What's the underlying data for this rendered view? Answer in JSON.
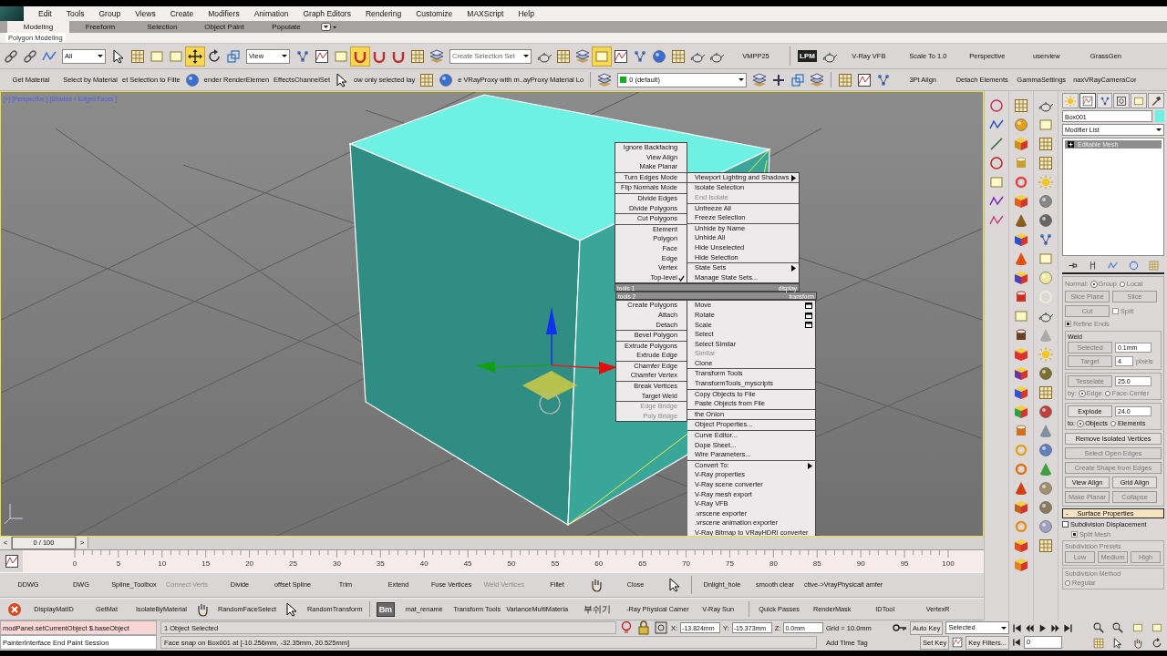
{
  "menu_bar": [
    "Edit",
    "Tools",
    "Group",
    "Views",
    "Create",
    "Modifiers",
    "Animation",
    "Graph Editors",
    "Rendering",
    "Customize",
    "MAXScript",
    "Help"
  ],
  "ribbon": {
    "tabs": [
      {
        "label": "Modeling",
        "selected": true
      },
      {
        "label": "Freeform",
        "selected": false
      },
      {
        "label": "Selection",
        "selected": false
      },
      {
        "label": "Object Paint",
        "selected": false
      },
      {
        "label": "Populate",
        "selected": false
      }
    ],
    "panel": "Polygon Modeling"
  },
  "main_toolbar": {
    "groups": [
      [
        {
          "kind": "icon",
          "selected": false
        },
        {
          "kind": "icon",
          "selected": false
        },
        {
          "kind": "icon",
          "selected": false
        },
        {
          "kind": "dropdown",
          "value": "All",
          "selected": false
        },
        {
          "kind": "icon",
          "selected": false
        },
        {
          "kind": "icon",
          "selected": false
        },
        {
          "kind": "icon",
          "selected": false
        },
        {
          "kind": "icon",
          "selected": false
        },
        {
          "kind": "icon",
          "selected": true
        },
        {
          "kind": "icon",
          "selected": false
        },
        {
          "kind": "icon",
          "selected": false
        },
        {
          "kind": "dropdown",
          "value": "View",
          "selected": false
        },
        {
          "kind": "icon",
          "selected": false
        },
        {
          "kind": "icon",
          "selected": false
        },
        {
          "kind": "icon",
          "selected": false
        },
        {
          "kind": "icon",
          "selected": true
        },
        {
          "kind": "icon",
          "selected": false
        },
        {
          "kind": "icon",
          "selected": false
        },
        {
          "kind": "icon",
          "selected": false
        },
        {
          "kind": "icon",
          "selected": false
        },
        {
          "kind": "dropdown",
          "placeholder": "Create Selection Set",
          "selected": false
        },
        {
          "kind": "icon",
          "selected": false
        },
        {
          "kind": "icon",
          "selected": false
        },
        {
          "kind": "icon",
          "selected": false
        },
        {
          "kind": "icon",
          "selected": true
        },
        {
          "kind": "icon",
          "selected": false
        },
        {
          "kind": "icon",
          "selected": false
        },
        {
          "kind": "icon",
          "selected": false
        },
        {
          "kind": "icon",
          "selected": false
        },
        {
          "kind": "icon",
          "selected": false
        },
        {
          "kind": "icon",
          "selected": false
        },
        {
          "kind": "text",
          "label": "VMPP25",
          "selected": false
        }
      ],
      [
        {
          "kind": "badge",
          "label": "LPM",
          "selected": false
        },
        {
          "kind": "icon",
          "selected": false
        },
        {
          "kind": "text",
          "label": "V-Ray VFB",
          "selected": false
        },
        {
          "kind": "text",
          "label": "Scale To 1.0",
          "selected": false
        },
        {
          "kind": "text",
          "label": "Perspective",
          "selected": false
        },
        {
          "kind": "text",
          "label": "userview",
          "selected": false
        },
        {
          "kind": "text",
          "label": "GrassGen",
          "selected": false
        }
      ]
    ]
  },
  "second_toolbar": {
    "groups": [
      [
        {
          "kind": "text",
          "label": "Get Material",
          "selected": false
        },
        {
          "kind": "text",
          "label": "Select by Material",
          "selected": false
        },
        {
          "kind": "text",
          "label": "et Selection to Filte",
          "selected": false
        },
        {
          "kind": "icon",
          "selected": false
        },
        {
          "kind": "text",
          "label": "ender RenderElemen",
          "selected": false
        },
        {
          "kind": "text",
          "label": "EffectsChannelSet",
          "selected": false
        },
        {
          "kind": "icon",
          "selected": false
        },
        {
          "kind": "text",
          "label": "ow only selected lay",
          "selected": false
        },
        {
          "kind": "icon",
          "selected": false
        },
        {
          "kind": "icon",
          "selected": false
        },
        {
          "kind": "text",
          "label": "e VRayProxy with m..ayProxy Material Lo",
          "selected": false
        }
      ],
      [
        {
          "kind": "icon",
          "selected": false
        },
        {
          "kind": "layer",
          "value": "0 (default)",
          "selected": false
        },
        {
          "kind": "icon",
          "selected": false
        },
        {
          "kind": "icon",
          "selected": false
        },
        {
          "kind": "icon",
          "selected": false
        },
        {
          "kind": "icon",
          "selected": false
        }
      ],
      [
        {
          "kind": "icon",
          "selected": false
        },
        {
          "kind": "icon",
          "selected": false
        },
        {
          "kind": "icon",
          "selected": false
        },
        {
          "kind": "text",
          "label": "3Pt Align",
          "selected": false
        },
        {
          "kind": "text",
          "label": "Detach Elements",
          "selected": false
        },
        {
          "kind": "text",
          "label": "GammaSettings",
          "selected": false
        },
        {
          "kind": "text",
          "label": "naxVRayCameraCor",
          "selected": false
        }
      ]
    ]
  },
  "viewport": {
    "label": "[+] [Perspective ] [Shaded + Edged Faces ]"
  },
  "quad_menu": {
    "quadrants": [
      {
        "title": "tools 1",
        "groups": [
          [
            {
              "label": "Ignore Backfacing",
              "disabled": false,
              "checked": false
            },
            {
              "label": "View Align",
              "disabled": false,
              "checked": false
            },
            {
              "label": "Make Planar",
              "disabled": false,
              "checked": false
            }
          ],
          [
            {
              "label": "Turn Edges Mode",
              "disabled": false,
              "checked": false
            }
          ],
          [
            {
              "label": "Flip Normals Mode",
              "disabled": false,
              "checked": false
            }
          ],
          [
            {
              "label": "Divide Edges",
              "disabled": false,
              "checked": false
            },
            {
              "label": "Divide Polygons",
              "disabled": false,
              "checked": false
            }
          ],
          [
            {
              "label": "Cut Polygons",
              "disabled": false,
              "checked": false
            }
          ],
          [
            {
              "label": "Element",
              "disabled": false,
              "checked": false
            },
            {
              "label": "Polygon",
              "disabled": false,
              "checked": false
            },
            {
              "label": "Face",
              "disabled": false,
              "checked": false
            },
            {
              "label": "Edge",
              "disabled": false,
              "checked": false
            },
            {
              "label": "Vertex",
              "disabled": false,
              "checked": false
            },
            {
              "label": "Top-level",
              "disabled": false,
              "checked": true
            }
          ]
        ]
      },
      {
        "title": "display",
        "groups": [
          [
            {
              "label": "Viewport Lighting and Shadows",
              "disabled": false,
              "kind": "submenu"
            }
          ],
          [
            {
              "label": "Isolate Selection",
              "disabled": false,
              "kind": "item"
            },
            {
              "label": "End Isolate",
              "disabled": true,
              "kind": "item"
            }
          ],
          [
            {
              "label": "Unfreeze All",
              "disabled": false,
              "kind": "item"
            },
            {
              "label": "Freeze Selection",
              "disabled": false,
              "kind": "item"
            }
          ],
          [
            {
              "label": "Unhide by Name",
              "disabled": false,
              "kind": "item"
            },
            {
              "label": "Unhide All",
              "disabled": false,
              "kind": "item"
            },
            {
              "label": "Hide Unselected",
              "disabled": false,
              "kind": "item"
            },
            {
              "label": "Hide Selection",
              "disabled": false,
              "kind": "item"
            }
          ],
          [
            {
              "label": "State Sets",
              "disabled": false,
              "kind": "submenu"
            },
            {
              "label": "Manage State Sets...",
              "disabled": false,
              "kind": "item"
            }
          ]
        ]
      },
      {
        "title": "tools 2",
        "groups": [
          [
            {
              "label": "Create Polygons",
              "disabled": false
            },
            {
              "label": "Attach",
              "disabled": false
            },
            {
              "label": "Detach",
              "disabled": false
            }
          ],
          [
            {
              "label": "Bevel Polygon",
              "disabled": false
            }
          ],
          [
            {
              "label": "Extrude Polygons",
              "disabled": false
            },
            {
              "label": "Extrude Edge",
              "disabled": false
            }
          ],
          [
            {
              "label": "Chamfer Edge",
              "disabled": false
            },
            {
              "label": "Chamfer Vertex",
              "disabled": false
            }
          ],
          [
            {
              "label": "Break Vertices",
              "disabled": false
            },
            {
              "label": "Target Weld",
              "disabled": false
            }
          ],
          [
            {
              "label": "Edge Bridge",
              "disabled": true
            },
            {
              "label": "Poly Bridge",
              "disabled": true
            }
          ]
        ]
      },
      {
        "title": "transform",
        "groups": [
          [
            {
              "label": "Move",
              "disabled": false,
              "kind": "options"
            },
            {
              "label": "Rotate",
              "disabled": false,
              "kind": "options"
            },
            {
              "label": "Scale",
              "disabled": false,
              "kind": "options"
            },
            {
              "label": "Select",
              "disabled": false,
              "kind": "item"
            },
            {
              "label": "Select Similar",
              "disabled": false,
              "kind": "item"
            },
            {
              "label": "Similar",
              "disabled": true,
              "kind": "item"
            },
            {
              "label": "Clone",
              "disabled": false,
              "kind": "item"
            }
          ],
          [
            {
              "label": "Transform Tools",
              "disabled": false,
              "kind": "item"
            },
            {
              "label": "TransformTools_myscripts",
              "disabled": false,
              "kind": "item"
            }
          ],
          [
            {
              "label": "Copy Objects to File",
              "disabled": false,
              "kind": "item"
            },
            {
              "label": "Paste Objects from File",
              "disabled": false,
              "kind": "item"
            }
          ],
          [
            {
              "label": "the Onion",
              "disabled": false,
              "kind": "item"
            }
          ],
          [
            {
              "label": "Object Properties...",
              "disabled": false,
              "kind": "item"
            }
          ],
          [
            {
              "label": "Curve Editor...",
              "disabled": false,
              "kind": "item"
            },
            {
              "label": "Dope Sheet...",
              "disabled": false,
              "kind": "item"
            },
            {
              "label": "Wire Parameters...",
              "disabled": false,
              "kind": "item"
            }
          ],
          [
            {
              "label": "Convert To:",
              "disabled": false,
              "kind": "submenu"
            },
            {
              "label": "V-Ray properties",
              "disabled": false,
              "kind": "item"
            },
            {
              "label": "V-Ray scene converter",
              "disabled": false,
              "kind": "item"
            },
            {
              "label": "V-Ray mesh export",
              "disabled": false,
              "kind": "item"
            },
            {
              "label": "V-Ray VFB",
              "disabled": false,
              "kind": "item"
            },
            {
              "label": ".vrscene exporter",
              "disabled": false,
              "kind": "item"
            },
            {
              "label": ".vrscene animation exporter",
              "disabled": false,
              "kind": "item"
            },
            {
              "label": "V-Ray Bitmap to VRayHDRI converter",
              "disabled": false,
              "kind": "item"
            }
          ]
        ]
      }
    ]
  },
  "command_panel": {
    "tabs": [
      {
        "selected": false
      },
      {
        "selected": true
      },
      {
        "selected": false
      },
      {
        "selected": false
      },
      {
        "selected": false
      },
      {
        "selected": false
      }
    ],
    "object_name": "Box001",
    "modifier_list": "Modifier List",
    "stack": [
      {
        "label": "Editable Mesh",
        "selected": true
      }
    ],
    "normal": {
      "label": "Normal:",
      "options": [
        {
          "label": "Group",
          "selected": true
        },
        {
          "label": "Local",
          "selected": false
        }
      ]
    },
    "slice_buttons": [
      {
        "label": "Slice Plane",
        "disabled": true
      },
      {
        "label": "Slice",
        "disabled": true
      }
    ],
    "cut_button": {
      "label": "Cut",
      "disabled": true
    },
    "split": {
      "label": "Split",
      "checked": false,
      "disabled": true
    },
    "refine_ends": {
      "label": "Refine Ends",
      "checked": true,
      "disabled": true
    },
    "weld": {
      "title": "Weld",
      "rows": [
        {
          "button": "Selected",
          "value": "0.1mm",
          "disabled": true
        },
        {
          "button": "Target",
          "value": "4",
          "suffix": "pixels",
          "disabled": true
        }
      ]
    },
    "tessellate": {
      "button": "Tesselate",
      "value": "25.0",
      "disabled": true,
      "label": "by:",
      "options": [
        {
          "label": "Edge",
          "selected": true
        },
        {
          "label": "Face-Center",
          "selected": false
        }
      ]
    },
    "explode": {
      "button": "Explode",
      "value": "24.0",
      "disabled": false,
      "label": "to:",
      "options": [
        {
          "label": "Objects",
          "selected": true
        },
        {
          "label": "Elements",
          "selected": false
        }
      ]
    },
    "wide_buttons": [
      {
        "label": "Remove Isolated Vertices",
        "disabled": false
      },
      {
        "label": "Select Open Edges",
        "disabled": true
      },
      {
        "label": "Create Shape from Edges",
        "disabled": true
      }
    ],
    "button_pairs": [
      [
        {
          "label": "View Align",
          "disabled": false
        },
        {
          "label": "Grid Align",
          "disabled": false
        }
      ],
      [
        {
          "label": "Make Planar",
          "disabled": true
        },
        {
          "label": "Collapse",
          "disabled": true
        }
      ]
    ],
    "surface": {
      "toggle": "-",
      "title": "Surface Properties",
      "checkboxes": [
        {
          "label": "Subdivision Displacement",
          "checked": false,
          "disabled": false
        },
        {
          "label": "Split Mesh",
          "checked": true,
          "disabled": true
        }
      ],
      "presets": {
        "title": "Subdivision Presets",
        "buttons": [
          {
            "label": "Low",
            "disabled": true
          },
          {
            "label": "Medium",
            "disabled": true
          },
          {
            "label": "High",
            "disabled": true
          }
        ]
      },
      "method": {
        "title": "Subdivision Method",
        "options": [
          {
            "label": "Regular",
            "selected": false
          }
        ]
      }
    }
  },
  "time_slider": {
    "prev": "<",
    "label": "0 / 100",
    "next": ">",
    "level": 0
  },
  "ruler_labels": [
    "0",
    "5",
    "10",
    "15",
    "20",
    "25",
    "30",
    "35",
    "40",
    "45",
    "50",
    "55",
    "60",
    "65",
    "70",
    "75",
    "80",
    "85",
    "90",
    "95",
    "100"
  ],
  "custom_toolbar_1": {
    "groups": [
      [
        {
          "kind": "text",
          "label": "DDWG",
          "disabled": false
        },
        {
          "kind": "text",
          "label": "DWG",
          "disabled": false
        },
        {
          "kind": "text",
          "label": "Spline_Toolbox",
          "disabled": false
        },
        {
          "kind": "text",
          "label": "Connect Verts",
          "disabled": true
        },
        {
          "kind": "text",
          "label": "Divide",
          "disabled": false
        },
        {
          "kind": "text",
          "label": "offset Spline",
          "disabled": false
        },
        {
          "kind": "text",
          "label": "Trim",
          "disabled": false
        },
        {
          "kind": "text",
          "label": "Extend",
          "disabled": false
        },
        {
          "kind": "text",
          "label": "Fuse Vertices",
          "disabled": false
        },
        {
          "kind": "text",
          "label": "Weld Vertices",
          "disabled": true
        },
        {
          "kind": "text",
          "label": "Fillet",
          "disabled": false
        },
        {
          "kind": "icon",
          "disabled": false
        },
        {
          "kind": "text",
          "label": "Close",
          "disabled": false
        },
        {
          "kind": "icon",
          "disabled": false
        }
      ],
      [
        {
          "kind": "text",
          "label": "Dnlight_hole",
          "disabled": false
        },
        {
          "kind": "text",
          "label": "smooth clear",
          "disabled": false
        },
        {
          "kind": "text",
          "label": "ctive->VrayPhysicalt amfer",
          "disabled": false
        }
      ]
    ]
  },
  "custom_toolbar_2": {
    "groups": [
      [
        {
          "kind": "icon",
          "disabled": false
        },
        {
          "kind": "text",
          "label": "DisplayMatID",
          "disabled": false
        },
        {
          "kind": "text",
          "label": "GetMat",
          "disabled": false
        },
        {
          "kind": "text",
          "label": "IsolateByMaterial",
          "disabled": false
        },
        {
          "kind": "icon",
          "disabled": false
        },
        {
          "kind": "text",
          "label": "RandomFaceSelect",
          "disabled": false
        },
        {
          "kind": "icon",
          "disabled": false
        },
        {
          "kind": "text",
          "label": "RandomTransform",
          "disabled": false
        }
      ],
      [
        {
          "kind": "badge",
          "label": "Bm",
          "disabled": false
        },
        {
          "kind": "text",
          "label": "mat_rename",
          "disabled": false
        },
        {
          "kind": "text",
          "label": "Transform Tools",
          "disabled": false
        },
        {
          "kind": "text",
          "label": "VarianceMultiMateria",
          "disabled": false
        },
        {
          "kind": "text",
          "label": "부쉬기",
          "disabled": false
        },
        {
          "kind": "text",
          "label": "-Ray Physical Camer",
          "disabled": false
        },
        {
          "kind": "text",
          "label": "V-Ray Sun",
          "disabled": false
        }
      ],
      [
        {
          "kind": "text",
          "label": "Quick Passes",
          "disabled": false
        },
        {
          "kind": "text",
          "label": "RenderMask",
          "disabled": false
        },
        {
          "kind": "text",
          "label": "IDTool",
          "disabled": false
        },
        {
          "kind": "text",
          "label": "VertexR",
          "disabled": false
        }
      ]
    ]
  },
  "status_bar": {
    "listener": [
      "modPanel.setCurrentObject $.baseObject",
      "PainterInterface End Paint Session"
    ],
    "selection": "1 Object Selected",
    "prompt": "Face snap on Box001 at [-10.256mm, -32.35mm, 20.525mm]",
    "coords": [
      {
        "label": "X:",
        "value": "-13.824mm"
      },
      {
        "label": "Y:",
        "value": "-15.373mm"
      },
      {
        "label": "Z:",
        "value": "0.0mm"
      }
    ],
    "grid": "Grid = 10.0mm",
    "add_time_tag": "Add Time Tag",
    "auto_key": "Auto Key",
    "key_mode": "Selected",
    "set_key": "Set Key",
    "key_filters": "Key Filters...",
    "frame": "0"
  }
}
